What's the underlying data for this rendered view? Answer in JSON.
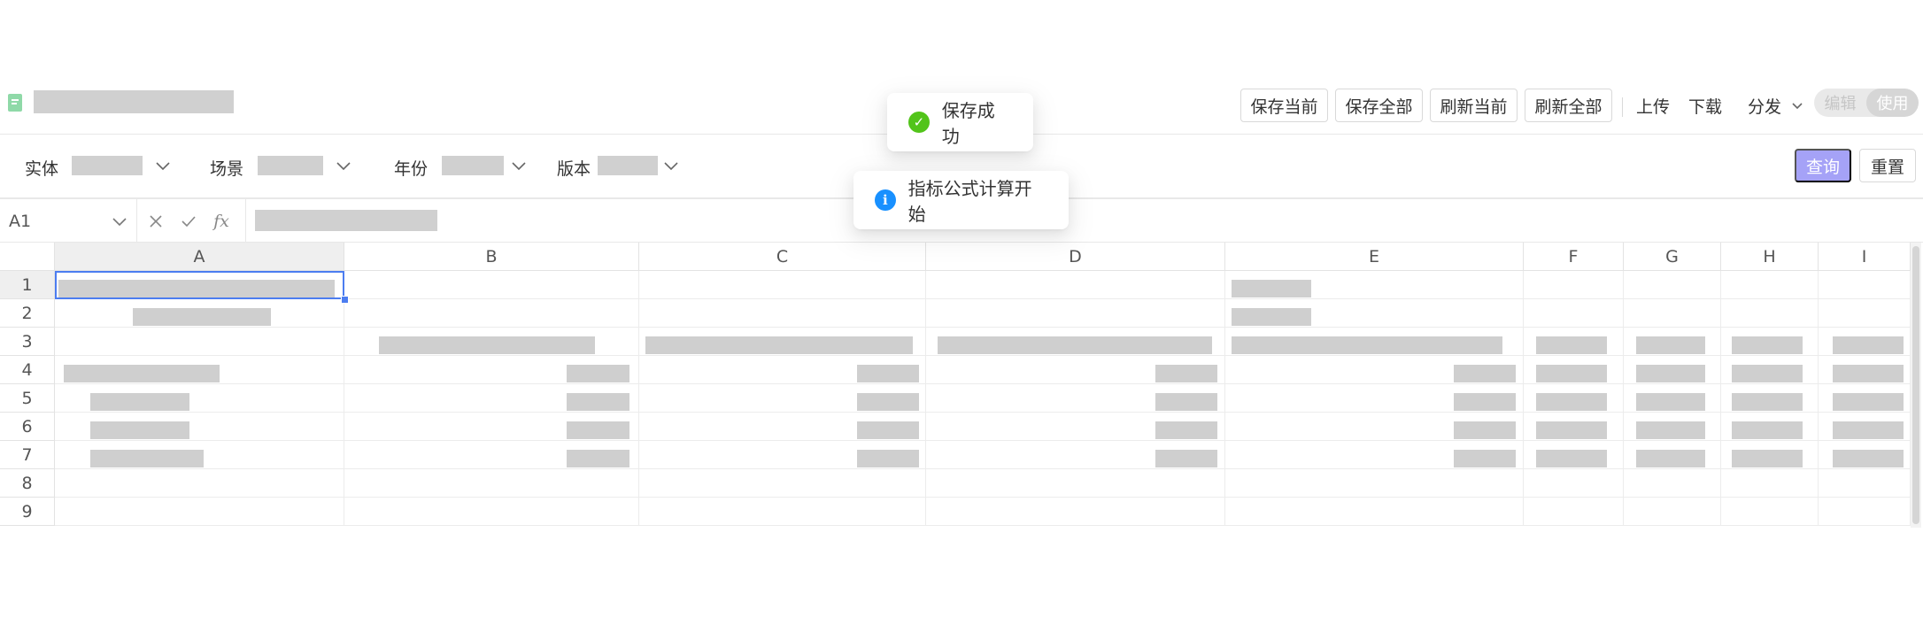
{
  "toolbar": {
    "save_current": "保存当前",
    "save_all": "保存全部",
    "refresh_current": "刷新当前",
    "refresh_all": "刷新全部",
    "upload": "上传",
    "download": "下载",
    "distribute": "分发",
    "mode_edit": "编辑",
    "mode_use": "使用",
    "active_mode": "使用"
  },
  "filters": {
    "entity_label": "实体",
    "scenario_label": "场景",
    "year_label": "年份",
    "version_label": "版本",
    "query_label": "查询",
    "reset_label": "重置"
  },
  "formula_bar": {
    "cell_ref": "A1",
    "cancel_icon": "close-icon",
    "confirm_icon": "check-icon",
    "fx": "fx"
  },
  "grid": {
    "columns": [
      "A",
      "B",
      "C",
      "D",
      "E",
      "F",
      "G",
      "H",
      "I"
    ],
    "rows": [
      "1",
      "2",
      "3",
      "4",
      "5",
      "6",
      "7",
      "8",
      "9"
    ],
    "selected_cell": "A1"
  },
  "toasts": {
    "success_text": "保存成功",
    "info_text": "指标公式计算开始"
  },
  "colors": {
    "accent": "#a5a2f7",
    "selection": "#4c7df0",
    "success": "#52c41a",
    "info": "#1890ff"
  }
}
